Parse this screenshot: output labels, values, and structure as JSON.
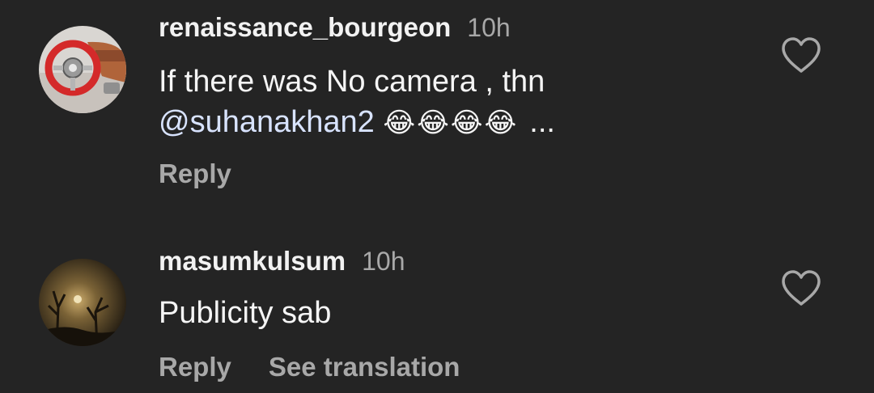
{
  "comments": [
    {
      "username": "renaissance_bourgeon",
      "time": "10h",
      "text_part1": "If there was No camera , thn",
      "mention": "@suhanakhan2",
      "emojis": "😂😂😂😂",
      "more": "...",
      "reply_label": "Reply",
      "avatar_icon": "steering-wheel-photo"
    },
    {
      "username": "masumkulsum",
      "time": "10h",
      "text": "Publicity sab",
      "reply_label": "Reply",
      "translate_label": "See translation",
      "avatar_icon": "moonlit-trees-photo"
    }
  ],
  "colors": {
    "background": "#242424",
    "username": "#f2f2f2",
    "secondary": "#a8a8a8",
    "mention": "#d8e3ff"
  }
}
